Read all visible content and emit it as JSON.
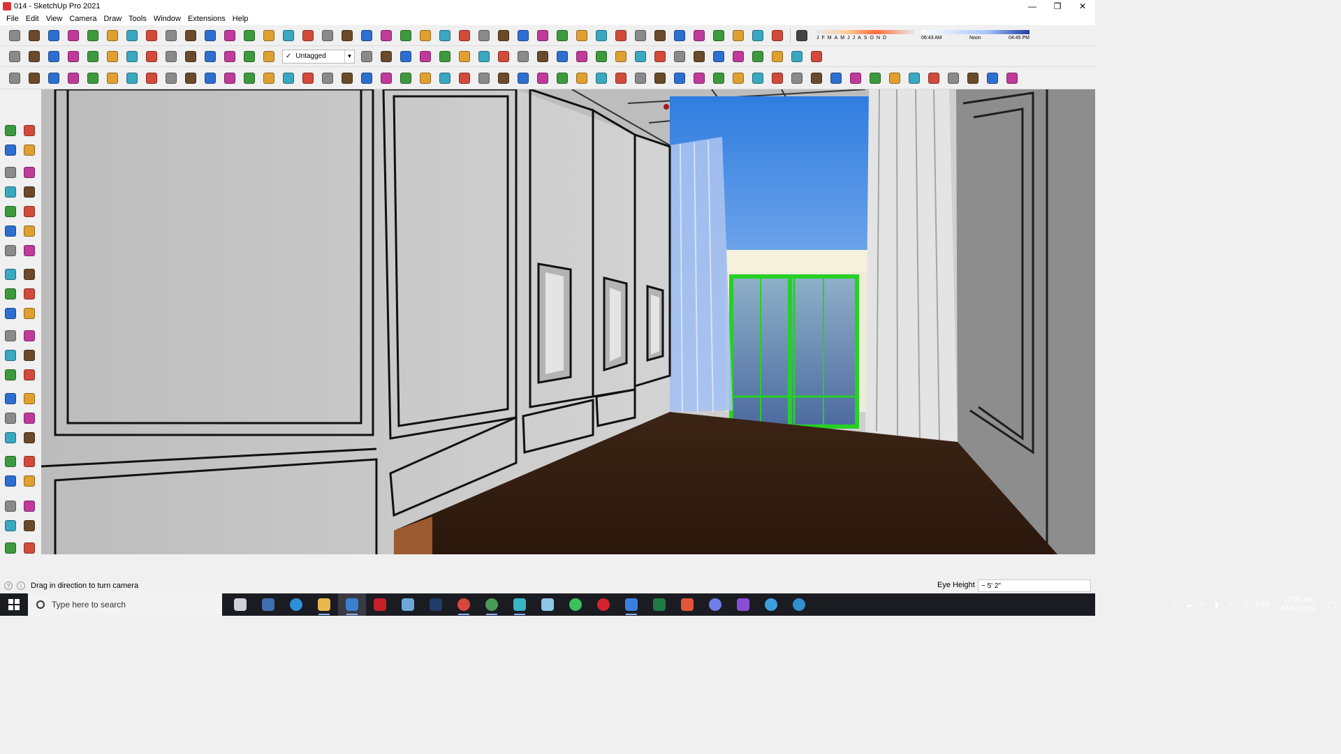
{
  "window": {
    "title": "014 - SketchUp Pro 2021",
    "controls": [
      "—",
      "❐",
      "✕"
    ]
  },
  "menu": [
    "File",
    "Edit",
    "View",
    "Camera",
    "Draw",
    "Tools",
    "Window",
    "Extensions",
    "Help"
  ],
  "toolbar": {
    "tag_selector": {
      "check": "✓",
      "value": "Untagged"
    },
    "shadow_months": [
      "J",
      "F",
      "M",
      "A",
      "M",
      "J",
      "J",
      "A",
      "S",
      "O",
      "N",
      "D"
    ],
    "shadow_time": {
      "start": "06:43 AM",
      "mid": "Noon",
      "end": "04:45 PM"
    }
  },
  "status": {
    "message": "Drag in direction to turn camera",
    "vcb_label": "Eye Height",
    "vcb_value": "~ 5' 2\""
  },
  "taskbar": {
    "search_placeholder": "Type here to search",
    "apps": [
      {
        "name": "task-view-icon",
        "color": "#cfd3da"
      },
      {
        "name": "calculator-icon",
        "color": "#3d6fb0"
      },
      {
        "name": "edge-icon",
        "color": "#2f8fd8"
      },
      {
        "name": "file-explorer-icon",
        "color": "#e8b84a"
      },
      {
        "name": "sketchup-icon",
        "color": "#3b7fd0"
      },
      {
        "name": "acrobat-icon",
        "color": "#c8202a"
      },
      {
        "name": "snipping-tool-icon",
        "color": "#6aa9d9"
      },
      {
        "name": "photoshop-icon",
        "color": "#1e3d68"
      },
      {
        "name": "chrome-icon",
        "color": "#d9463b"
      },
      {
        "name": "chrome-profile-icon",
        "color": "#4a9b57"
      },
      {
        "name": "sketchup-layout-icon",
        "color": "#39b5c6"
      },
      {
        "name": "notes-icon",
        "color": "#8ec7e8"
      },
      {
        "name": "whatsapp-icon",
        "color": "#38c45a"
      },
      {
        "name": "opera-icon",
        "color": "#d3232f"
      },
      {
        "name": "tasks-icon",
        "color": "#3a7fe0"
      },
      {
        "name": "excel-icon",
        "color": "#1f7a45"
      },
      {
        "name": "grammarly-icon",
        "color": "#e4563a"
      },
      {
        "name": "discord-icon",
        "color": "#6f7ee8"
      },
      {
        "name": "podcast-icon",
        "color": "#8a4ed6"
      },
      {
        "name": "telegram-icon",
        "color": "#3ba1dd"
      },
      {
        "name": "telegram-2-icon",
        "color": "#2f8fcf"
      }
    ],
    "tray": {
      "language": "ENG",
      "time": "12:28 AM",
      "date": "04/04/2022"
    }
  }
}
